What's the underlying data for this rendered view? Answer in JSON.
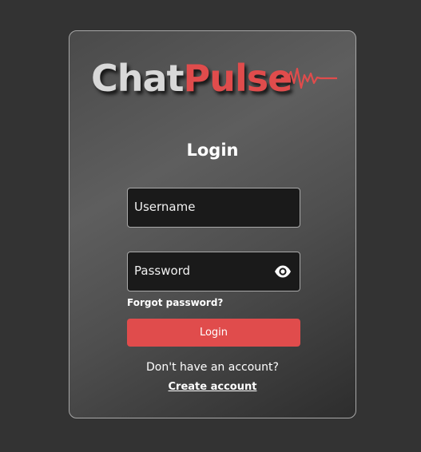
{
  "brand": {
    "name_part1": "Chat",
    "name_part2": "Pulse",
    "accent_color": "#e04c4c",
    "logo_icon": "heartbeat-pulse-line"
  },
  "login_form": {
    "title": "Login",
    "username": {
      "placeholder": "Username",
      "value": ""
    },
    "password": {
      "placeholder": "Password",
      "value": "",
      "toggle_icon": "eye-icon"
    },
    "forgot_password_label": "Forgot password?",
    "submit_label": "Login",
    "no_account_text": "Don't have an account?",
    "create_account_label": "Create account"
  },
  "colors": {
    "background": "#333333",
    "card_border": "#a8a8a8",
    "input_background": "#1a1a1a",
    "button": "#e04c4c",
    "text": "#ffffff"
  }
}
